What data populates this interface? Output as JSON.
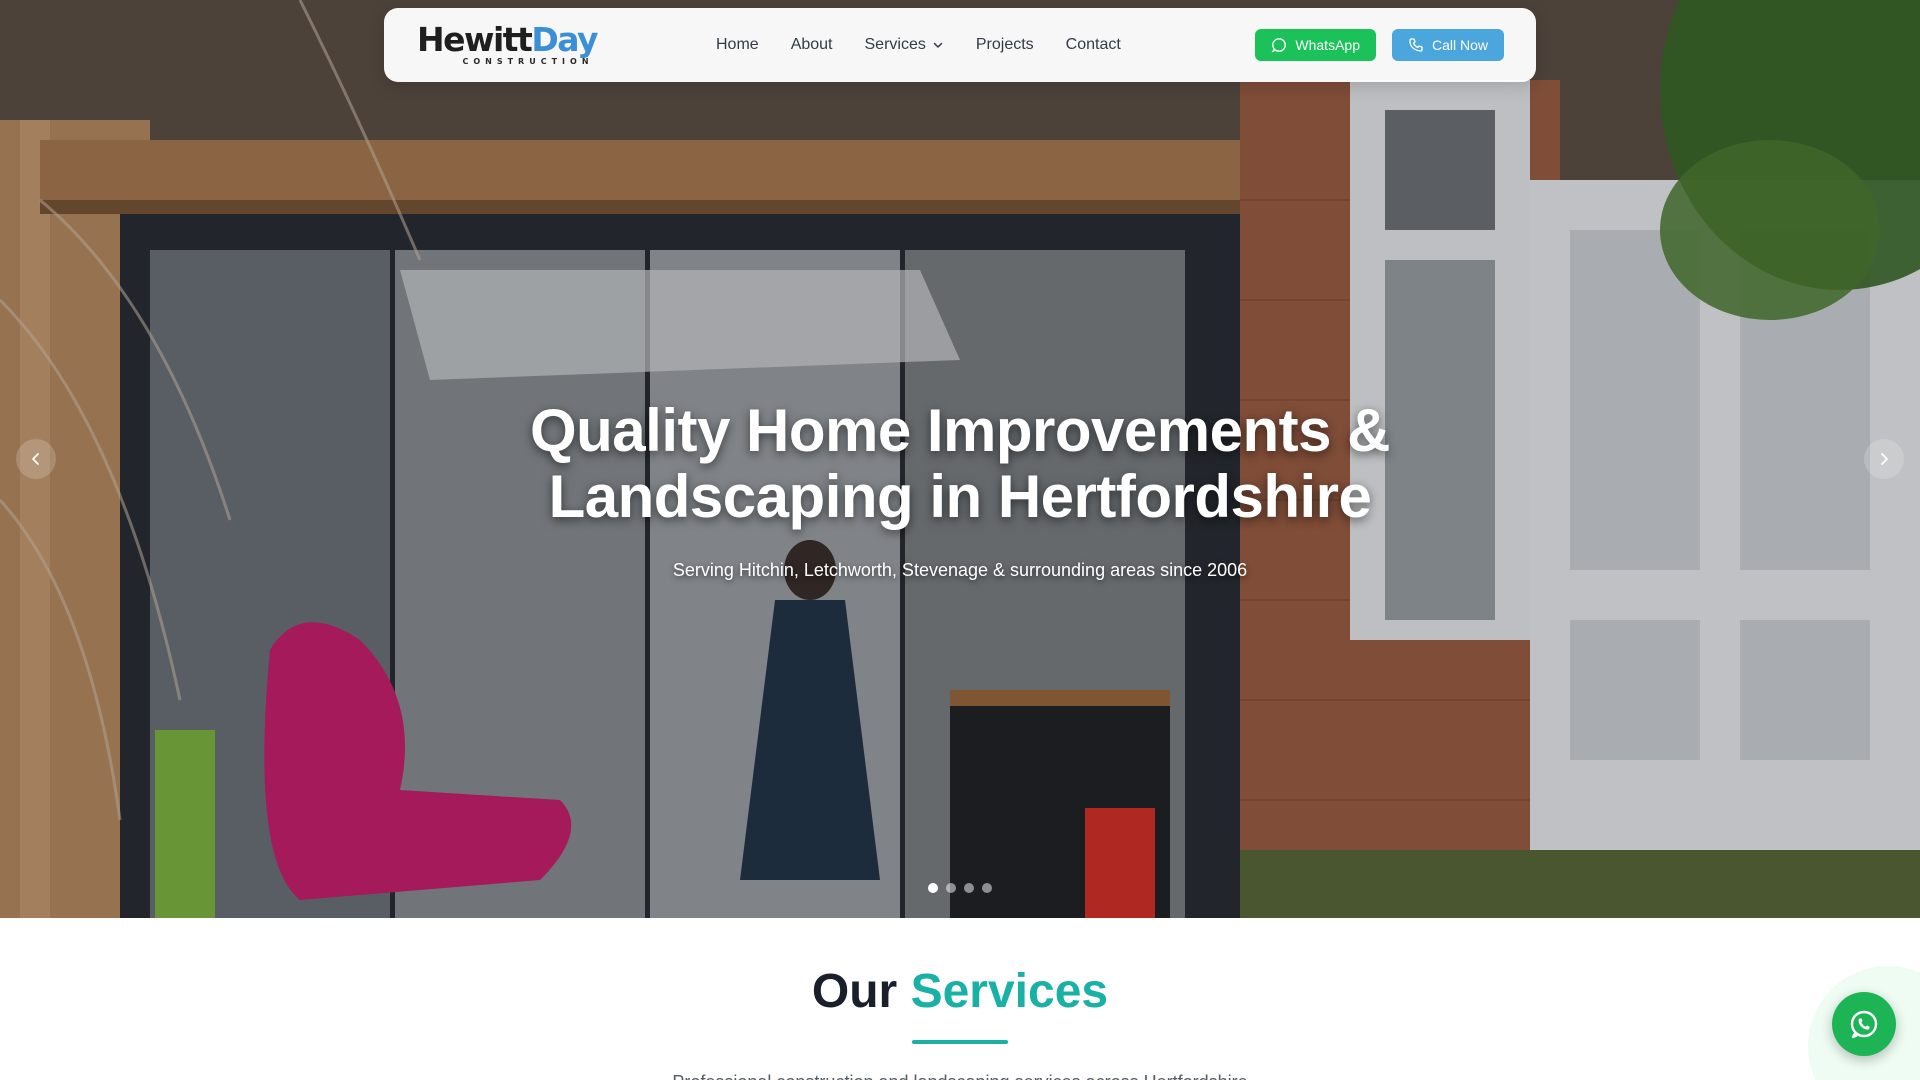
{
  "brand": {
    "name_part1": "Hewitt",
    "name_part2": "Day",
    "tagline": "CONSTRUCTION"
  },
  "nav": {
    "items": [
      {
        "label": "Home"
      },
      {
        "label": "About"
      },
      {
        "label": "Services",
        "has_dropdown": true
      },
      {
        "label": "Projects"
      },
      {
        "label": "Contact"
      }
    ],
    "whatsapp_label": "WhatsApp",
    "call_label": "Call Now"
  },
  "hero": {
    "title_line1": "Quality Home Improvements &",
    "title_line2": "Landscaping in Hertfordshire",
    "subtitle": "Serving Hitchin, Letchworth, Stevenage & surrounding areas since 2006",
    "slide_count": 4,
    "active_slide": 1
  },
  "services": {
    "title_part1": "Our",
    "title_part2": "Services",
    "subtitle": "Professional construction and landscaping services across Hertfordshire"
  },
  "colors": {
    "accent_teal": "#19b0a6",
    "whatsapp_green": "#1bc259",
    "call_blue": "#4aa6dc",
    "logo_blue": "#3b8fd6"
  },
  "icons": {
    "whatsapp": "whatsapp-icon",
    "phone": "phone-icon",
    "chevron": "chevron-down-icon",
    "prev": "chevron-left-icon",
    "next": "chevron-right-icon"
  }
}
